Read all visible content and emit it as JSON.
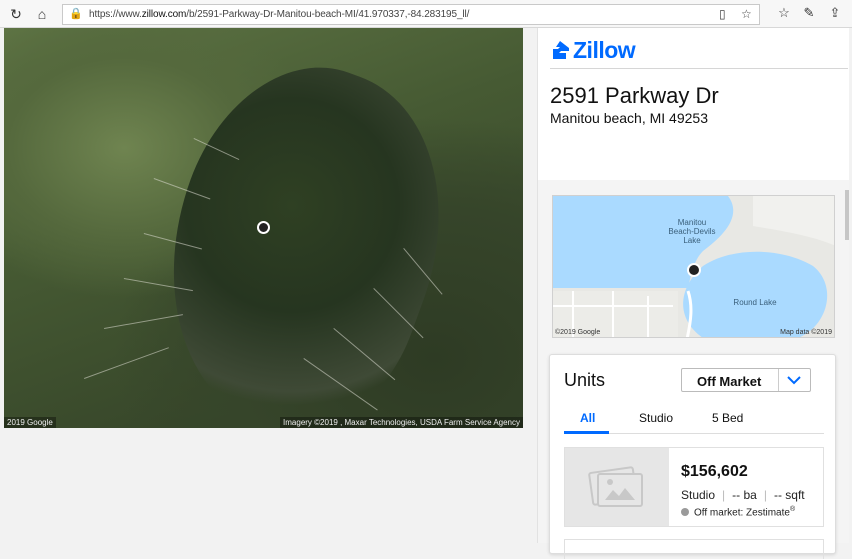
{
  "browser": {
    "url_prefix": "https://www.",
    "url_domain": "zillow.com",
    "url_path": "/b/2591-Parkway-Dr-Manitou-beach-MI/41.970337,-84.283195_ll/"
  },
  "map": {
    "credit_left": "2019 Google",
    "credit_right": "Imagery ©2019 , Maxar Technologies, USDA Farm Service Agency"
  },
  "header": {
    "logo_text": "Zillow",
    "brand_color": "#006aff"
  },
  "property": {
    "address": "2591 Parkway Dr",
    "city_line": "Manitou beach, MI 49253"
  },
  "mini_map": {
    "label_lake1": "Manitou Beach-Devils Lake",
    "label_lake2": "Round Lake",
    "credit_left": "©2019 Google",
    "credit_right": "Map data ©2019"
  },
  "units": {
    "title": "Units",
    "filter_selected": "Off Market",
    "tabs": [
      "All",
      "Studio",
      "5 Bed"
    ],
    "active_tab": "All",
    "rows": [
      {
        "price": "$156,602",
        "type": "Studio",
        "baths": "-- ba",
        "sqft": "-- sqft",
        "status": "Off market: Zestimate",
        "status_mark": "®"
      }
    ]
  }
}
